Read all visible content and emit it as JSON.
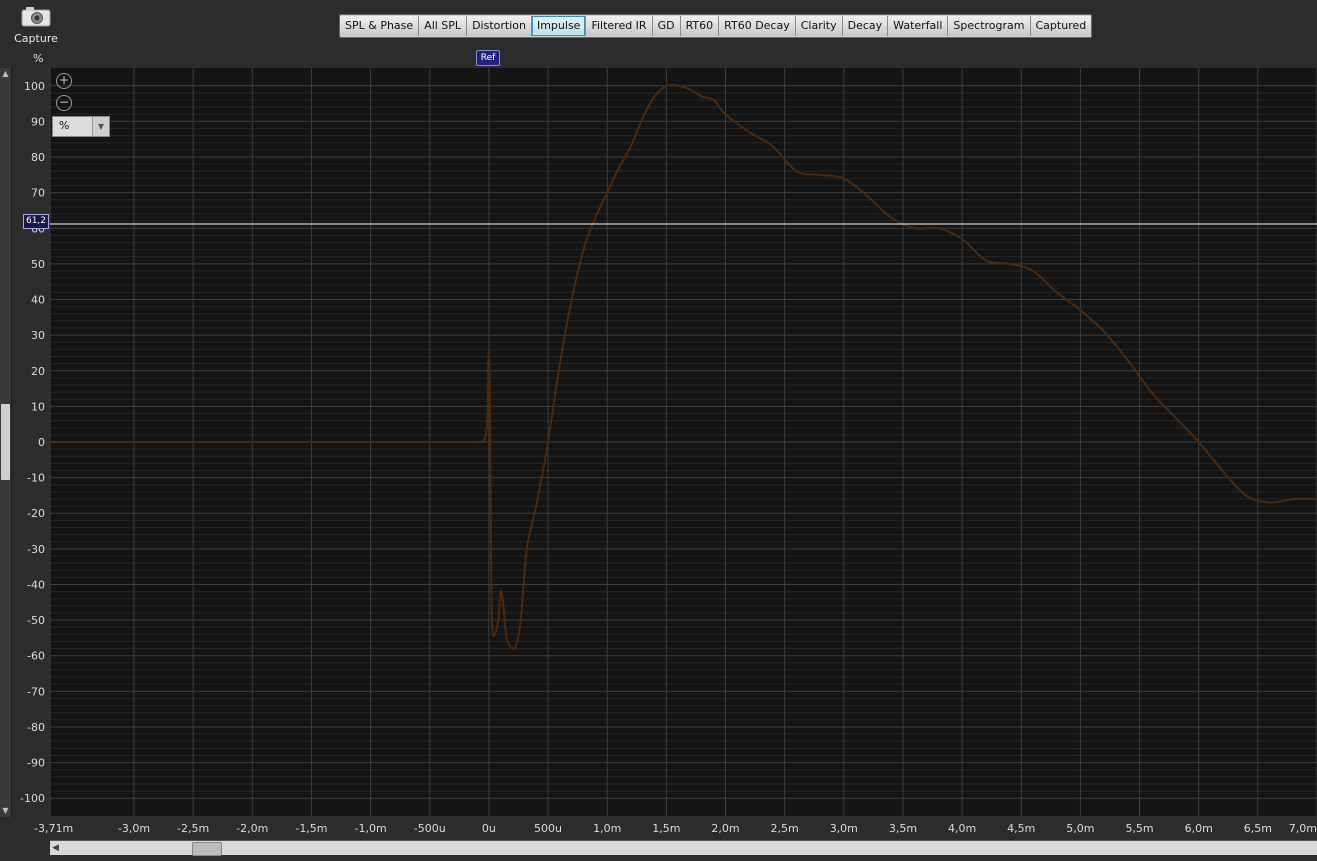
{
  "capture": {
    "label": "Capture",
    "icon": "camera-icon"
  },
  "tabs": [
    {
      "label": "SPL & Phase",
      "active": false
    },
    {
      "label": "All SPL",
      "active": false
    },
    {
      "label": "Distortion",
      "active": false
    },
    {
      "label": "Impulse",
      "active": true
    },
    {
      "label": "Filtered IR",
      "active": false
    },
    {
      "label": "GD",
      "active": false
    },
    {
      "label": "RT60",
      "active": false
    },
    {
      "label": "RT60 Decay",
      "active": false
    },
    {
      "label": "Clarity",
      "active": false
    },
    {
      "label": "Decay",
      "active": false
    },
    {
      "label": "Waterfall",
      "active": false
    },
    {
      "label": "Spectrogram",
      "active": false
    },
    {
      "label": "Captured",
      "active": false
    }
  ],
  "ref_marker": "Ref",
  "y_unit_label": "%",
  "unit_select": {
    "value": "%",
    "icon": "chevron-down-icon"
  },
  "zoom": {
    "in_icon": "zoom-in-icon",
    "out_icon": "zoom-out-icon"
  },
  "cursor": {
    "value": 61.2,
    "label": "61,2"
  },
  "colors": {
    "background": "#141414",
    "grid": "#3e3e3e",
    "trace": "#4a2a10",
    "cursor": "#ffffff",
    "tab_active": "#bfe0e8"
  },
  "chart_data": {
    "type": "line",
    "title": "",
    "xlabel": "",
    "ylabel": "%",
    "xlim": [
      -3.71,
      7.0
    ],
    "ylim": [
      -105,
      105
    ],
    "grid": true,
    "x_ticks": [
      {
        "v": -3.71,
        "label": "-3,71m"
      },
      {
        "v": -3.0,
        "label": "-3,0m"
      },
      {
        "v": -2.5,
        "label": "-2,5m"
      },
      {
        "v": -2.0,
        "label": "-2,0m"
      },
      {
        "v": -1.5,
        "label": "-1,5m"
      },
      {
        "v": -1.0,
        "label": "-1,0m"
      },
      {
        "v": -0.5,
        "label": "-500u"
      },
      {
        "v": 0,
        "label": "0u"
      },
      {
        "v": 0.5,
        "label": "500u"
      },
      {
        "v": 1.0,
        "label": "1,0m"
      },
      {
        "v": 1.5,
        "label": "1,5m"
      },
      {
        "v": 2.0,
        "label": "2,0m"
      },
      {
        "v": 2.5,
        "label": "2,5m"
      },
      {
        "v": 3.0,
        "label": "3,0m"
      },
      {
        "v": 3.5,
        "label": "3,5m"
      },
      {
        "v": 4.0,
        "label": "4,0m"
      },
      {
        "v": 4.5,
        "label": "4,5m"
      },
      {
        "v": 5.0,
        "label": "5,0m"
      },
      {
        "v": 5.5,
        "label": "5,5m"
      },
      {
        "v": 6.0,
        "label": "6,0m"
      },
      {
        "v": 6.5,
        "label": "6,5m"
      },
      {
        "v": 7.0,
        "label": "7,0m"
      }
    ],
    "y_ticks": [
      {
        "v": 100,
        "label": "100"
      },
      {
        "v": 90,
        "label": "90"
      },
      {
        "v": 80,
        "label": "80"
      },
      {
        "v": 70,
        "label": "70"
      },
      {
        "v": 60,
        "label": "60"
      },
      {
        "v": 50,
        "label": "50"
      },
      {
        "v": 40,
        "label": "40"
      },
      {
        "v": 30,
        "label": "30"
      },
      {
        "v": 20,
        "label": "20"
      },
      {
        "v": 10,
        "label": "10"
      },
      {
        "v": 0,
        "label": "0"
      },
      {
        "v": -10,
        "label": "-10"
      },
      {
        "v": -20,
        "label": "-20"
      },
      {
        "v": -30,
        "label": "-30"
      },
      {
        "v": -40,
        "label": "-40"
      },
      {
        "v": -50,
        "label": "-50"
      },
      {
        "v": -60,
        "label": "-60"
      },
      {
        "v": -70,
        "label": "-70"
      },
      {
        "v": -80,
        "label": "-80"
      },
      {
        "v": -90,
        "label": "-90"
      },
      {
        "v": -100,
        "label": "-100"
      }
    ],
    "series": [
      {
        "x": [
          -3.71,
          -1.0,
          -0.12,
          -0.08,
          -0.04,
          -0.02,
          -0.01,
          0.0,
          0.01,
          0.02,
          0.03,
          0.05,
          0.08,
          0.1,
          0.12,
          0.15,
          0.2,
          0.23,
          0.27,
          0.32,
          0.4,
          0.5,
          0.6,
          0.7,
          0.8,
          0.9,
          1.0,
          1.1,
          1.2,
          1.3,
          1.4,
          1.5,
          1.6,
          1.7,
          1.8,
          1.9,
          2.0,
          2.2,
          2.4,
          2.6,
          2.8,
          3.0,
          3.2,
          3.4,
          3.6,
          3.8,
          4.0,
          4.2,
          4.4,
          4.6,
          4.8,
          5.0,
          5.2,
          5.4,
          5.6,
          5.8,
          6.0,
          6.2,
          6.4,
          6.6,
          6.8,
          7.0
        ],
        "values": [
          0,
          0,
          0,
          0,
          0.5,
          3,
          10,
          26,
          5,
          -40,
          -53,
          -54,
          -50,
          -42,
          -45,
          -55,
          -58,
          -57,
          -50,
          -30,
          -18,
          0,
          22,
          40,
          54,
          63,
          70,
          77,
          83,
          91,
          97,
          100,
          100,
          99,
          97,
          96,
          92,
          87,
          83,
          76,
          75,
          74,
          69,
          63,
          60,
          60,
          57,
          51,
          50,
          48,
          42,
          37,
          31,
          23,
          14,
          7,
          0,
          -8,
          -15,
          -17,
          -16,
          -16
        ]
      }
    ]
  }
}
